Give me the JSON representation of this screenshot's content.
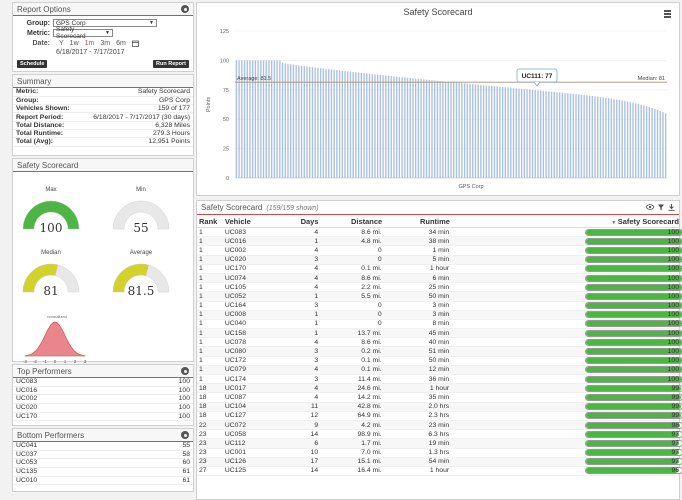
{
  "report_options": {
    "title": "Report Options",
    "group_label": "Group:",
    "group_value": "GPS Corp",
    "metric_label": "Metric:",
    "metric_value": "Safety Scorecard",
    "date_label": "Date:",
    "date_options": [
      "Y",
      "1w",
      "1m",
      "3m",
      "6m"
    ],
    "active_date": "1m",
    "date_range": "6/18/2017 - 7/17/2017",
    "schedule_label": "Schedule",
    "run_report_label": "Run Report"
  },
  "summary": {
    "title": "Summary",
    "rows": [
      {
        "label": "Metric:",
        "value": "Safety Scorecard"
      },
      {
        "label": "Group:",
        "value": "GPS Corp"
      },
      {
        "label": "Vehicles Shown:",
        "value": "159 of 177"
      },
      {
        "label": "Report Period:",
        "value": "6/18/2017 - 7/17/2017 (30 days)"
      },
      {
        "label": "Total Distance:",
        "value": "6,328 Miles"
      },
      {
        "label": "Total Runtime:",
        "value": "279.3 Hours"
      },
      {
        "label": "Total (Avg):",
        "value": "12,951 Points"
      }
    ]
  },
  "scorecard_panel": {
    "title": "Safety Scorecard",
    "gauges": [
      {
        "label": "Max",
        "value": "100",
        "fraction": 1.0,
        "color": "#4cb543"
      },
      {
        "label": "Min",
        "value": "55",
        "fraction": 0.0,
        "color": "#e6e6e6"
      },
      {
        "label": "Median",
        "value": "81",
        "fraction": 0.58,
        "color": "#d2d22a"
      },
      {
        "label": "Average",
        "value": "81.5",
        "fraction": 0.59,
        "color": "#d2d22a"
      }
    ],
    "normal_label": "normalized",
    "normal_ticks": [
      "-3",
      "-2",
      "-1",
      "0",
      "1",
      "2",
      "3"
    ]
  },
  "top_performers": {
    "title": "Top Performers",
    "items": [
      {
        "name": "UC083",
        "score": "100"
      },
      {
        "name": "UC016",
        "score": "100"
      },
      {
        "name": "UC002",
        "score": "100"
      },
      {
        "name": "UC020",
        "score": "100"
      },
      {
        "name": "UC170",
        "score": "100"
      }
    ]
  },
  "bottom_performers": {
    "title": "Bottom Performers",
    "items": [
      {
        "name": "UC041",
        "score": "55"
      },
      {
        "name": "UC037",
        "score": "58"
      },
      {
        "name": "UC053",
        "score": "60"
      },
      {
        "name": "UC135",
        "score": "61"
      },
      {
        "name": "UC010",
        "score": "61"
      }
    ]
  },
  "chart_data": {
    "type": "bar",
    "title": "Safety Scorecard",
    "xlabel": "GPS Corp",
    "ylabel": "Points",
    "ylim": [
      0,
      125
    ],
    "yticks": [
      0,
      25,
      50,
      75,
      100,
      125
    ],
    "bar_count": 159,
    "max": 100,
    "min": 55,
    "average_label": "Average: 81.5",
    "average": 81.5,
    "median_label": "Median: 81",
    "median": 81,
    "tooltip": "UC111: 77",
    "tooltip_value": 77,
    "bar_color": "#a9bfe3",
    "average_color": "#a39271"
  },
  "table": {
    "title": "Safety Scorecard",
    "subtitle": "(159/159 shown)",
    "columns": {
      "rank": "Rank",
      "vehicle": "Vehicle",
      "days": "Days",
      "distance": "Distance",
      "runtime": "Runtime",
      "score": "Safety Scorecard"
    },
    "bar_color": "#4cb543",
    "rows": [
      {
        "rank": "1",
        "vehicle": "UC083",
        "days": "4",
        "distance": "8.6 mi.",
        "runtime": "34 min",
        "score": 100
      },
      {
        "rank": "1",
        "vehicle": "UC016",
        "days": "1",
        "distance": "4.8 mi.",
        "runtime": "38 min",
        "score": 100
      },
      {
        "rank": "1",
        "vehicle": "UC002",
        "days": "4",
        "distance": "0",
        "runtime": "1 min",
        "score": 100
      },
      {
        "rank": "1",
        "vehicle": "UC020",
        "days": "3",
        "distance": "0",
        "runtime": "5 min",
        "score": 100
      },
      {
        "rank": "1",
        "vehicle": "UC170",
        "days": "4",
        "distance": "0.1 mi.",
        "runtime": "1 hour",
        "score": 100
      },
      {
        "rank": "1",
        "vehicle": "UC074",
        "days": "4",
        "distance": "8.6 mi.",
        "runtime": "6 min",
        "score": 100
      },
      {
        "rank": "1",
        "vehicle": "UC105",
        "days": "4",
        "distance": "2.2 mi.",
        "runtime": "25 min",
        "score": 100
      },
      {
        "rank": "1",
        "vehicle": "UC052",
        "days": "1",
        "distance": "5.5 mi.",
        "runtime": "50 min",
        "score": 100
      },
      {
        "rank": "1",
        "vehicle": "UC164",
        "days": "3",
        "distance": "0",
        "runtime": "3 min",
        "score": 100
      },
      {
        "rank": "1",
        "vehicle": "UC008",
        "days": "1",
        "distance": "0",
        "runtime": "3 min",
        "score": 100
      },
      {
        "rank": "1",
        "vehicle": "UC040",
        "days": "1",
        "distance": "0",
        "runtime": "8 min",
        "score": 100
      },
      {
        "rank": "1",
        "vehicle": "UC158",
        "days": "1",
        "distance": "13.7 mi.",
        "runtime": "45 min",
        "score": 100
      },
      {
        "rank": "1",
        "vehicle": "UC078",
        "days": "4",
        "distance": "8.6 mi.",
        "runtime": "40 min",
        "score": 100
      },
      {
        "rank": "1",
        "vehicle": "UC080",
        "days": "3",
        "distance": "0.2 mi.",
        "runtime": "51 min",
        "score": 100
      },
      {
        "rank": "1",
        "vehicle": "UC172",
        "days": "3",
        "distance": "0.1 mi.",
        "runtime": "50 min",
        "score": 100
      },
      {
        "rank": "1",
        "vehicle": "UC079",
        "days": "4",
        "distance": "0.1 mi.",
        "runtime": "12 min",
        "score": 100
      },
      {
        "rank": "1",
        "vehicle": "UC174",
        "days": "3",
        "distance": "11.4 mi.",
        "runtime": "36 min",
        "score": 100
      },
      {
        "rank": "18",
        "vehicle": "UC017",
        "days": "4",
        "distance": "24.6 mi.",
        "runtime": "1 hour",
        "score": 99
      },
      {
        "rank": "18",
        "vehicle": "UC087",
        "days": "4",
        "distance": "14.2 mi.",
        "runtime": "35 min",
        "score": 99
      },
      {
        "rank": "18",
        "vehicle": "UC104",
        "days": "11",
        "distance": "42.8 mi.",
        "runtime": "2.0 hrs",
        "score": 99
      },
      {
        "rank": "18",
        "vehicle": "UC127",
        "days": "12",
        "distance": "64.9 mi.",
        "runtime": "2.3 hrs",
        "score": 99
      },
      {
        "rank": "22",
        "vehicle": "UC072",
        "days": "9",
        "distance": "4.2 mi.",
        "runtime": "23 min",
        "score": 98
      },
      {
        "rank": "23",
        "vehicle": "UC058",
        "days": "14",
        "distance": "98.9 mi.",
        "runtime": "6.3 hrs",
        "score": 97
      },
      {
        "rank": "23",
        "vehicle": "UC112",
        "days": "6",
        "distance": "1.7 mi.",
        "runtime": "19 min",
        "score": 97
      },
      {
        "rank": "23",
        "vehicle": "UC001",
        "days": "10",
        "distance": "7.0 mi.",
        "runtime": "1.3 hrs",
        "score": 97
      },
      {
        "rank": "23",
        "vehicle": "UC126",
        "days": "17",
        "distance": "15.1 mi.",
        "runtime": "54 min",
        "score": 97
      },
      {
        "rank": "27",
        "vehicle": "UC125",
        "days": "14",
        "distance": "16.4 mi.",
        "runtime": "1 hour",
        "score": 96
      }
    ]
  }
}
